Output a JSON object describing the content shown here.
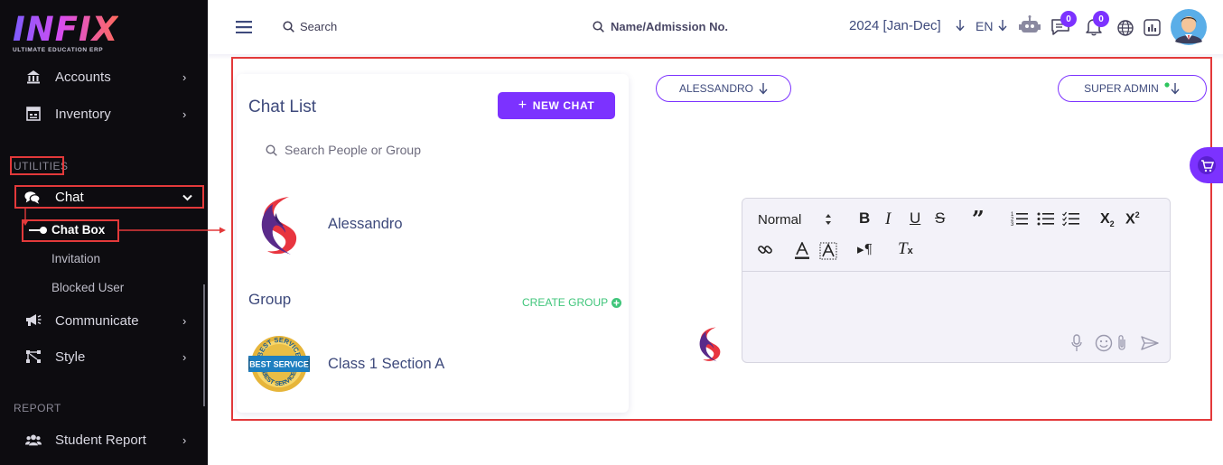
{
  "brand": {
    "name": "INFIX",
    "tagline": "ULTIMATE EDUCATION ERP"
  },
  "sidebar": {
    "items": [
      {
        "label": "Accounts",
        "icon": "bank-icon"
      },
      {
        "label": "Inventory",
        "icon": "inventory-icon"
      }
    ],
    "section_utilities": "UTILITIES",
    "chat": {
      "label": "Chat",
      "icon": "chat-bubbles-icon"
    },
    "sub_items": [
      "Chat Box",
      "Invitation",
      "Blocked User"
    ],
    "more_items": [
      {
        "label": "Communicate",
        "icon": "megaphone-icon"
      },
      {
        "label": "Style",
        "icon": "style-icon"
      }
    ],
    "section_report": "REPORT",
    "report_items": [
      {
        "label": "Student Report",
        "icon": "users-icon"
      }
    ]
  },
  "topbar": {
    "search_label": "Search",
    "admission_search": "Name/Admission No.",
    "session": "2024 [Jan-Dec]",
    "language": "EN",
    "chat_badge": "0",
    "notification_badge": "0"
  },
  "chat_list": {
    "title": "Chat List",
    "new_chat_label": "NEW CHAT",
    "search_placeholder": "Search People or Group",
    "contacts": [
      {
        "name": "Alessandro"
      }
    ],
    "group_title": "Group",
    "create_group_label": "CREATE GROUP",
    "groups": [
      {
        "name": "Class 1 Section A",
        "badge_text": [
          "BEST SERVICE",
          "BEST SERVICE",
          "BEST SERVICE"
        ]
      }
    ]
  },
  "conversation": {
    "recipient": "ALESSANDRO",
    "role": "SUPER ADMIN",
    "editor": {
      "format_select": "Normal"
    }
  },
  "colors": {
    "accent": "#7c32ff",
    "sidebar_bg": "#0d0c10",
    "highlight_red": "#e3393a",
    "success_green": "#3fc57a",
    "text_navy": "#3e4a7c"
  }
}
